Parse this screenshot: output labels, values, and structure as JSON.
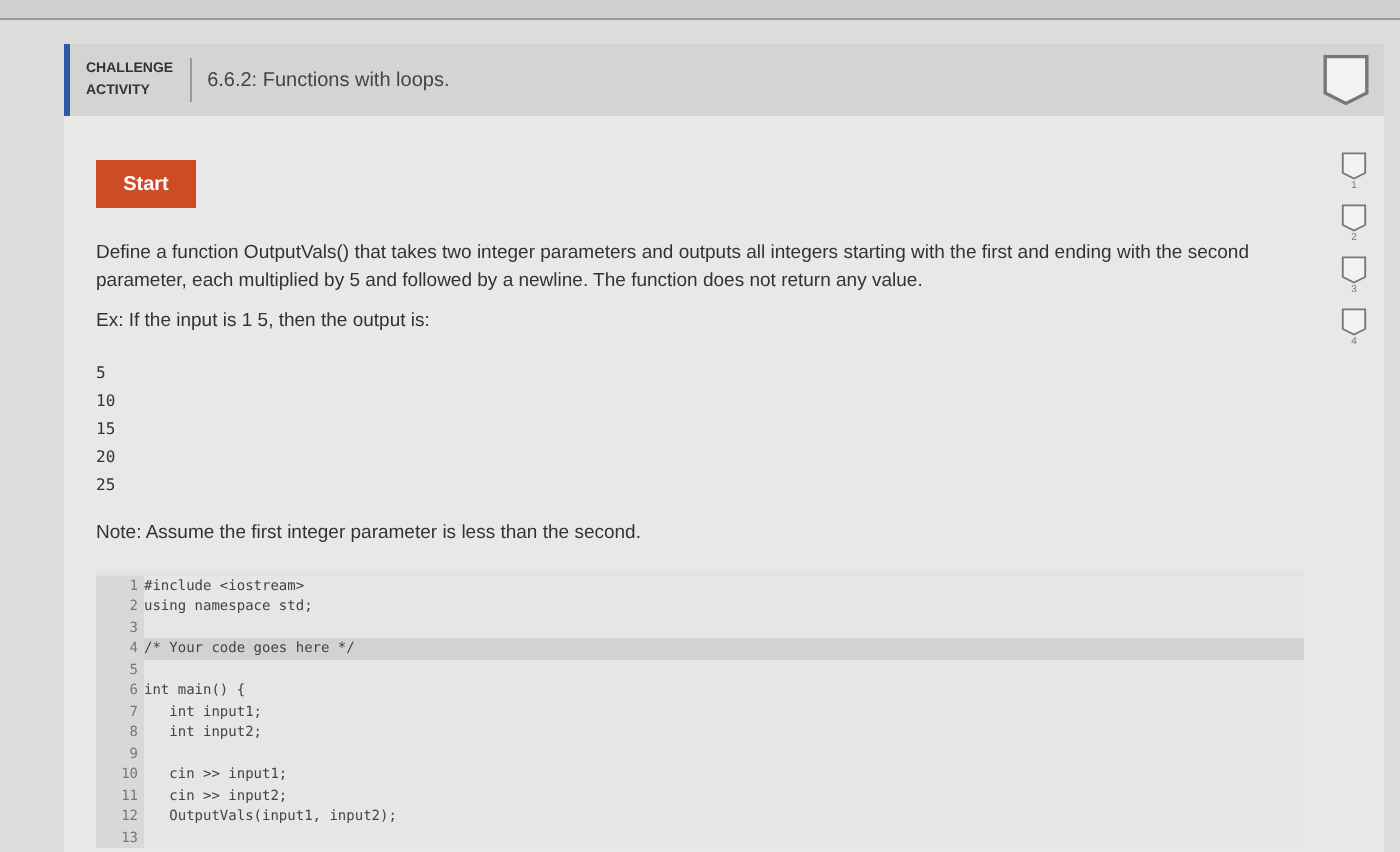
{
  "header": {
    "label_line_1": "CHALLENGE",
    "label_line_2": "ACTIVITY",
    "title": "6.6.2: Functions with loops.",
    "completed": false
  },
  "start_button": "Start",
  "prompt": "Define a function OutputVals() that takes two integer parameters and outputs all integers starting with the first and ending with the second parameter, each multiplied by 5 and followed by a newline. The function does not return any value.",
  "example": "Ex: If the input is 1 5, then the output is:",
  "output_lines": [
    "5",
    "10",
    "15",
    "20",
    "25"
  ],
  "note": "Note: Assume the first integer parameter is less than the second.",
  "code_lines": [
    {
      "number": "1",
      "text": "#include <iostream>",
      "selected": false
    },
    {
      "number": "2",
      "text": "using namespace std;",
      "selected": false
    },
    {
      "number": "3",
      "selected": false
    },
    {
      "number": "4",
      "text": "/* Your code goes here */",
      "selected": true
    },
    {
      "number": "5",
      "selected": false
    },
    {
      "number": "6",
      "text": "int main() {",
      "selected": false
    },
    {
      "number": "7",
      "text": "   int input1;",
      "selected": false
    },
    {
      "number": "8",
      "text": "   int input2;",
      "selected": false
    },
    {
      "number": "9",
      "selected": false
    },
    {
      "number": "10",
      "text": "   cin >> input1;",
      "selected": false
    },
    {
      "number": "11",
      "text": "   cin >> input2;",
      "selected": false
    },
    {
      "number": "12",
      "text": "   OutputVals(input1, input2);",
      "selected": false
    },
    {
      "number": "13",
      "selected": false
    }
  ],
  "levels": [
    {
      "number": "1",
      "completed": false
    },
    {
      "number": "2",
      "completed": false
    },
    {
      "number": "3",
      "completed": false
    },
    {
      "number": "4",
      "completed": false
    }
  ]
}
